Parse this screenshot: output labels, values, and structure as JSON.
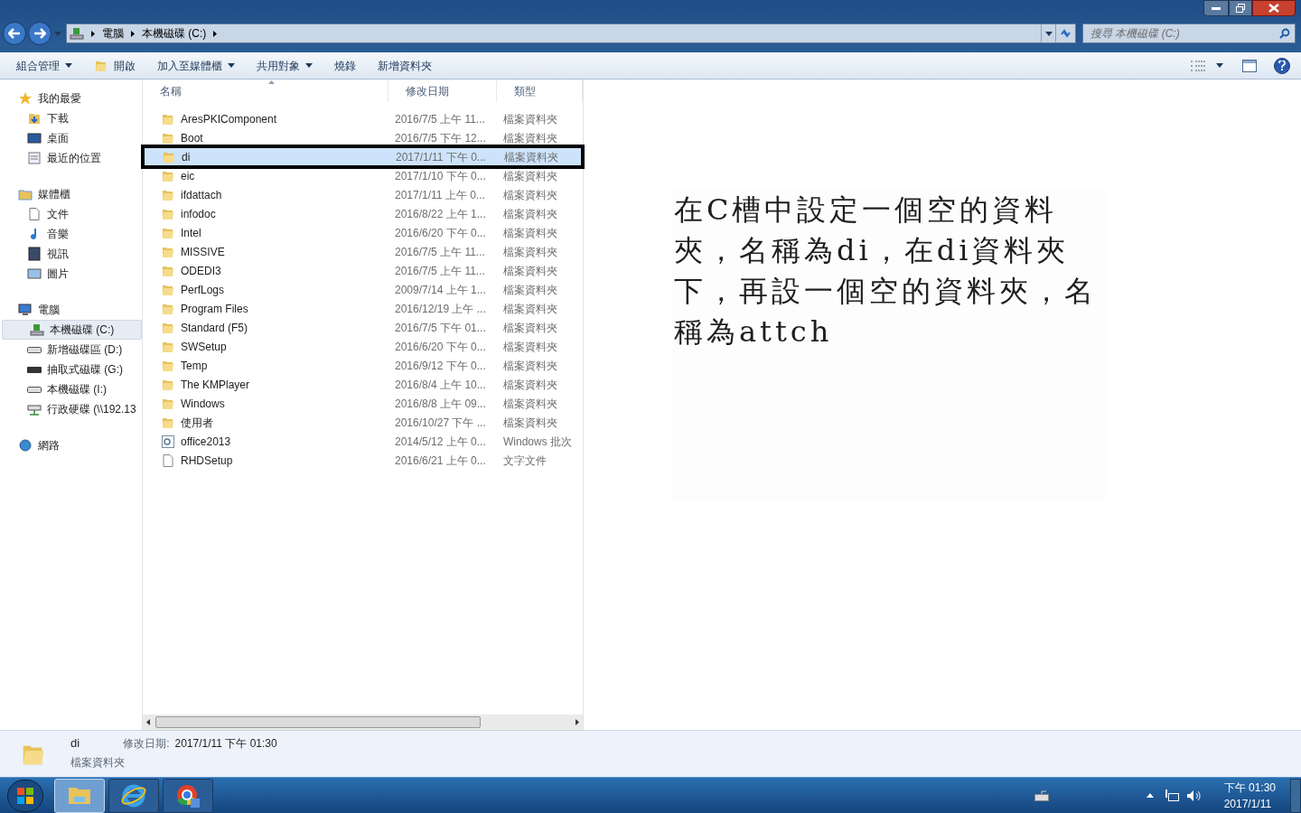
{
  "address_bar": {
    "breadcrumbs": [
      "電腦",
      "本機磁碟 (C:)"
    ]
  },
  "search": {
    "placeholder": "搜尋 本機磁碟 (C:)"
  },
  "toolbar": [
    {
      "label": "組合管理",
      "kind": "menu"
    },
    {
      "label": "開啟",
      "kind": "open"
    },
    {
      "label": "加入至媒體櫃",
      "kind": "menu"
    },
    {
      "label": "共用對象",
      "kind": "menu"
    },
    {
      "label": "燒錄",
      "kind": "plain"
    },
    {
      "label": "新增資料夾",
      "kind": "plain"
    }
  ],
  "sidebar": [
    {
      "label": "我的最愛",
      "kind": "star",
      "selected": false,
      "children": [
        {
          "label": "下載",
          "kind": "download",
          "selected": false
        },
        {
          "label": "桌面",
          "kind": "desktop",
          "selected": false
        },
        {
          "label": "最近的位置",
          "kind": "recent",
          "selected": false
        }
      ]
    },
    {
      "label": "媒體櫃",
      "kind": "library",
      "selected": false,
      "children": [
        {
          "label": "文件",
          "kind": "doc",
          "selected": false
        },
        {
          "label": "音樂",
          "kind": "music",
          "selected": false
        },
        {
          "label": "視訊",
          "kind": "video",
          "selected": false
        },
        {
          "label": "圖片",
          "kind": "picture",
          "selected": false
        }
      ]
    },
    {
      "label": "電腦",
      "kind": "computer",
      "selected": false,
      "children": [
        {
          "label": "本機磁碟 (C:)",
          "kind": "sysdrive",
          "selected": true
        },
        {
          "label": "新增磁碟區 (D:)",
          "kind": "drive",
          "selected": false
        },
        {
          "label": "抽取式磁碟 (G:)",
          "kind": "removable",
          "selected": false
        },
        {
          "label": "本機磁碟 (I:)",
          "kind": "drive",
          "selected": false
        },
        {
          "label": "行政硬碟 (\\\\192.13",
          "kind": "netdrive",
          "selected": false
        }
      ]
    },
    {
      "label": "網路",
      "kind": "network",
      "selected": false
    }
  ],
  "table": {
    "columns": [
      "名稱",
      "修改日期",
      "類型"
    ],
    "rows": [
      {
        "name": "AresPKIComponent",
        "date": "2016/7/5 上午 11...",
        "type": "檔案資料夾",
        "kind": "folder",
        "selected": false
      },
      {
        "name": "Boot",
        "date": "2016/7/5 下午 12...",
        "type": "檔案資料夾",
        "kind": "folder",
        "selected": false
      },
      {
        "name": "di",
        "date": "2017/1/11 下午 0...",
        "type": "檔案資料夾",
        "kind": "folder",
        "selected": true
      },
      {
        "name": "eic",
        "date": "2017/1/10 下午 0...",
        "type": "檔案資料夾",
        "kind": "folder",
        "selected": false
      },
      {
        "name": "ifdattach",
        "date": "2017/1/11 上午 0...",
        "type": "檔案資料夾",
        "kind": "folder",
        "selected": false
      },
      {
        "name": "infodoc",
        "date": "2016/8/22 上午 1...",
        "type": "檔案資料夾",
        "kind": "folder",
        "selected": false
      },
      {
        "name": "Intel",
        "date": "2016/6/20 下午 0...",
        "type": "檔案資料夾",
        "kind": "folder",
        "selected": false
      },
      {
        "name": "MISSIVE",
        "date": "2016/7/5 上午 11...",
        "type": "檔案資料夾",
        "kind": "folder",
        "selected": false
      },
      {
        "name": "ODEDI3",
        "date": "2016/7/5 上午 11...",
        "type": "檔案資料夾",
        "kind": "folder",
        "selected": false
      },
      {
        "name": "PerfLogs",
        "date": "2009/7/14 上午 1...",
        "type": "檔案資料夾",
        "kind": "folder",
        "selected": false
      },
      {
        "name": "Program Files",
        "date": "2016/12/19 上午 ...",
        "type": "檔案資料夾",
        "kind": "folder",
        "selected": false
      },
      {
        "name": "Standard (F5)",
        "date": "2016/7/5 下午 01...",
        "type": "檔案資料夾",
        "kind": "folder",
        "selected": false
      },
      {
        "name": "SWSetup",
        "date": "2016/6/20 下午 0...",
        "type": "檔案資料夾",
        "kind": "folder",
        "selected": false
      },
      {
        "name": "Temp",
        "date": "2016/9/12 下午 0...",
        "type": "檔案資料夾",
        "kind": "folder",
        "selected": false
      },
      {
        "name": "The KMPlayer",
        "date": "2016/8/4 上午 10...",
        "type": "檔案資料夾",
        "kind": "folder",
        "selected": false
      },
      {
        "name": "Windows",
        "date": "2016/8/8 上午 09...",
        "type": "檔案資料夾",
        "kind": "folder",
        "selected": false
      },
      {
        "name": "使用者",
        "date": "2016/10/27 下午 ...",
        "type": "檔案資料夾",
        "kind": "folder",
        "selected": false
      },
      {
        "name": "office2013",
        "date": "2014/5/12 上午 0...",
        "type": "Windows 批次",
        "kind": "batch",
        "selected": false
      },
      {
        "name": "RHDSetup",
        "date": "2016/6/21 上午 0...",
        "type": "文字文件",
        "kind": "text",
        "selected": false
      }
    ]
  },
  "annotation": "在C槽中設定一個空的資料夾，名稱為di，在di資料夾下，再設一個空的資料夾，名稱為attch",
  "details": {
    "name": "di",
    "date_label": "修改日期:",
    "date": "2017/1/11 下午 01:30",
    "type": "檔案資料夾"
  },
  "taskbar": {
    "apps": [
      {
        "kind": "explorer",
        "selected": true
      },
      {
        "kind": "browser-e",
        "selected": false
      },
      {
        "kind": "browser-ring",
        "selected": false
      }
    ],
    "time": "下午 01:30",
    "date": "2017/1/11"
  }
}
